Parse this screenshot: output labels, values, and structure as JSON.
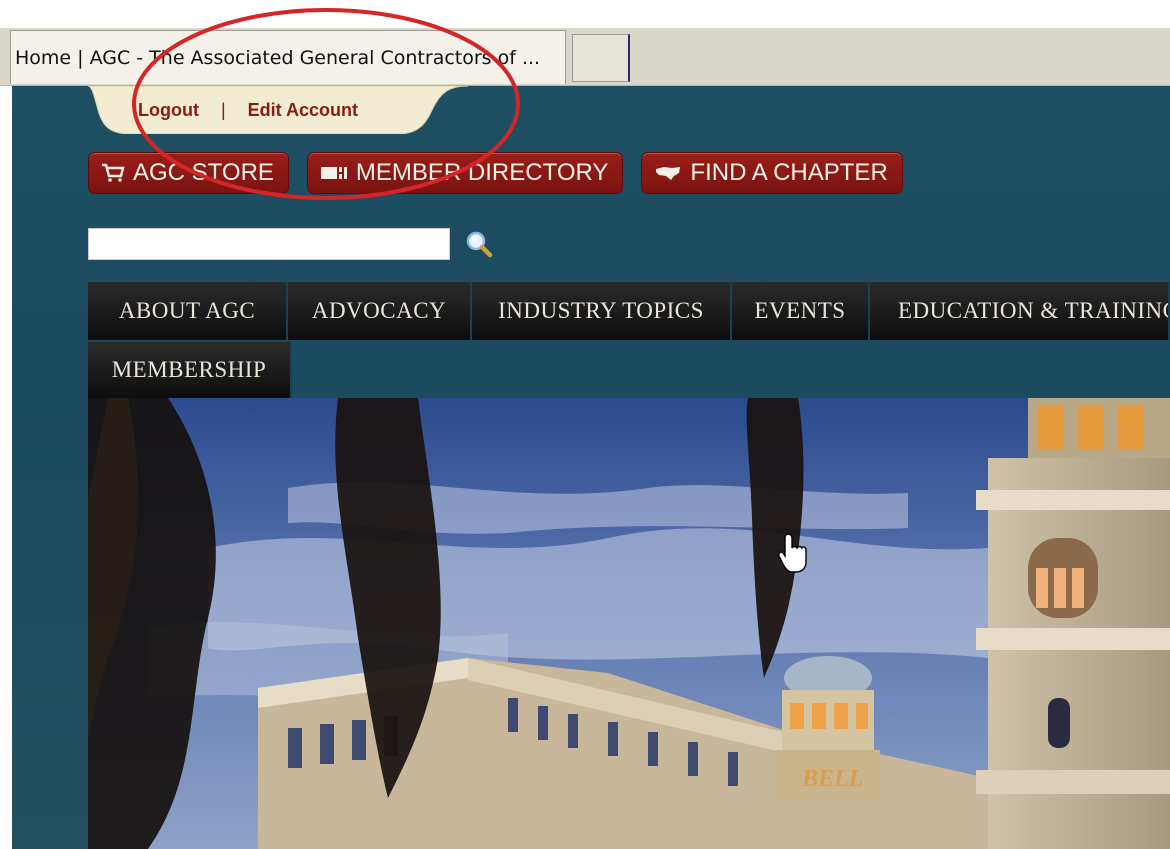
{
  "browser": {
    "active_tab_title": "Home | AGC - The Associated General Contractors of ..."
  },
  "account": {
    "logout_label": "Logout",
    "separator": "|",
    "edit_account_label": "Edit Account"
  },
  "quick_links": {
    "store_label": "AGC STORE",
    "directory_label": "MEMBER DIRECTORY",
    "chapter_label": "FIND A CHAPTER"
  },
  "search": {
    "value": "",
    "placeholder": ""
  },
  "nav": {
    "items": [
      {
        "label": "ABOUT AGC"
      },
      {
        "label": "ADVOCACY"
      },
      {
        "label": "INDUSTRY TOPICS"
      },
      {
        "label": "EVENTS"
      },
      {
        "label": "EDUCATION & TRAINING"
      },
      {
        "label": "MEMBERSHIP"
      }
    ]
  },
  "hero": {
    "sign_text": "BELL"
  },
  "colors": {
    "site_bg": "#1e4f63",
    "button_red": "#8b1a14",
    "annotation_red": "#d42626",
    "nav_black": "#111111"
  },
  "icons": [
    "cart-icon",
    "directory-icon",
    "map-icon",
    "search-icon",
    "hand-cursor-icon"
  ]
}
